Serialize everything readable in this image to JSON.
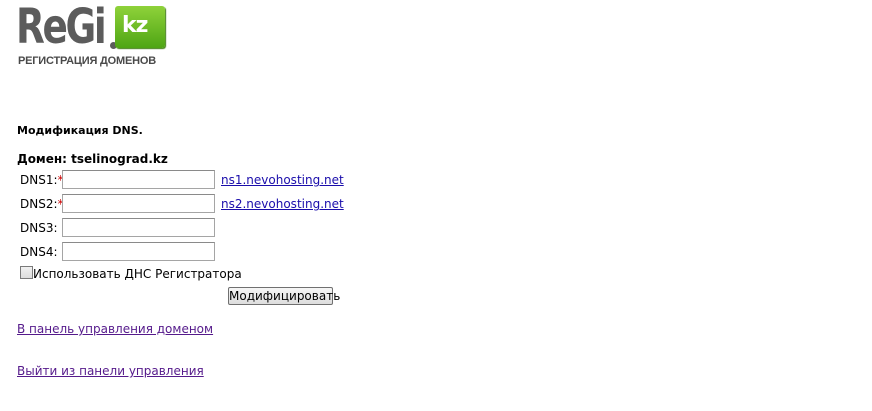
{
  "logo": {
    "wordmark": "ReGi",
    "badge": "kz",
    "tagline": "РЕГИСТРАЦИЯ ДОМЕНОВ",
    "colors": {
      "wordmark": "#5c5c5c",
      "badge": "#6abf2a"
    }
  },
  "form": {
    "heading": "Модификация DNS.",
    "domain_label": "Домен: tselinograd.kz",
    "rows": [
      {
        "label": "DNS1:",
        "required": "*",
        "value": "",
        "suggestion": "ns1.nevohosting.net"
      },
      {
        "label": "DNS2:",
        "required": "*",
        "value": "",
        "suggestion": "ns2.nevohosting.net"
      },
      {
        "label": "DNS3:",
        "required": "",
        "value": ""
      },
      {
        "label": "DNS4:",
        "required": "",
        "value": ""
      }
    ],
    "use_registrar_dns_label": "Использовать ДНС Регистратора",
    "submit_label": "Модифицировать"
  },
  "links": {
    "domain_panel": "В панель управления доменом",
    "logout": "Выйти из панели управления"
  },
  "colors": {
    "required": "#cc0000",
    "link": "#1a0dab",
    "visited_link": "#551a8b"
  }
}
